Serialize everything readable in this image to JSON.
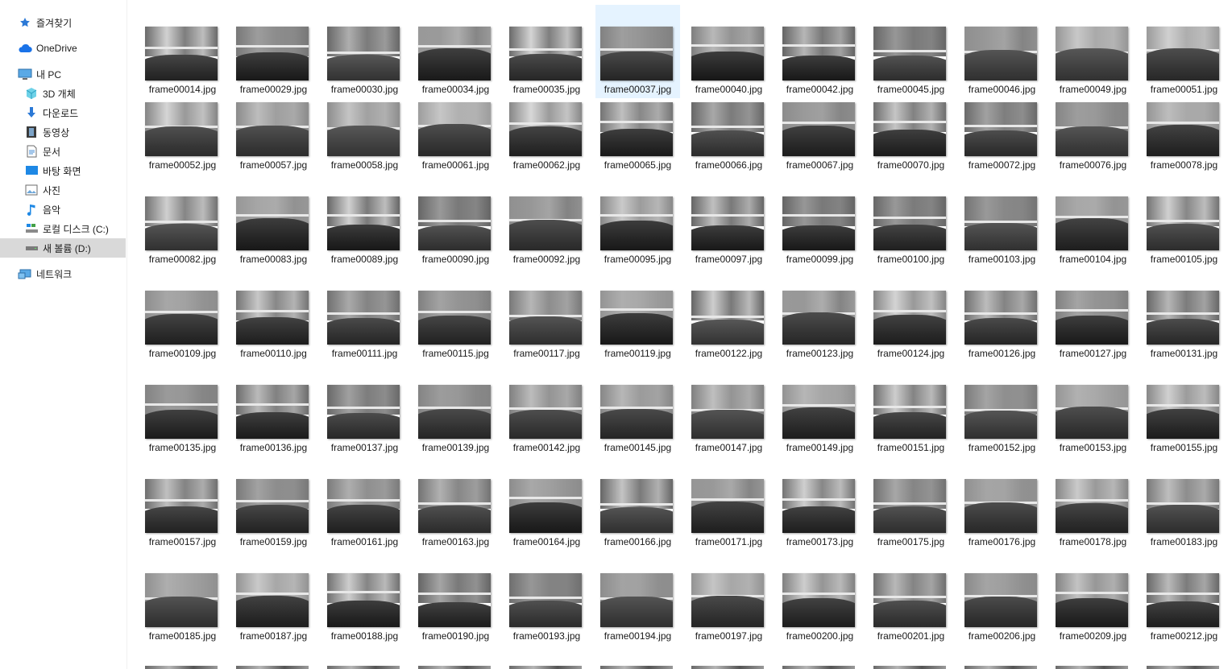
{
  "sidebar": {
    "items": [
      {
        "label": "즐겨찾기",
        "icon": "star-icon",
        "level": 0,
        "selected": false
      },
      {
        "label": "OneDrive",
        "icon": "cloud-icon",
        "level": 0,
        "selected": false
      },
      {
        "label": "내 PC",
        "icon": "computer-icon",
        "level": 0,
        "selected": false
      },
      {
        "label": "3D 개체",
        "icon": "cube-icon",
        "level": 1,
        "selected": false
      },
      {
        "label": "다운로드",
        "icon": "download-arrow-icon",
        "level": 1,
        "selected": false
      },
      {
        "label": "동영상",
        "icon": "film-icon",
        "level": 1,
        "selected": false
      },
      {
        "label": "문서",
        "icon": "document-icon",
        "level": 1,
        "selected": false
      },
      {
        "label": "바탕 화면",
        "icon": "desktop-icon",
        "level": 1,
        "selected": false
      },
      {
        "label": "사진",
        "icon": "picture-icon",
        "level": 1,
        "selected": false
      },
      {
        "label": "음악",
        "icon": "music-note-icon",
        "level": 1,
        "selected": false
      },
      {
        "label": "로컬 디스크 (C:)",
        "icon": "local-disk-icon",
        "level": 1,
        "selected": false
      },
      {
        "label": "새 볼륨 (D:)",
        "icon": "drive-icon",
        "level": 1,
        "selected": true
      },
      {
        "label": "네트워크",
        "icon": "network-icon",
        "level": 0,
        "selected": false
      }
    ]
  },
  "files": {
    "selected": "frame00037.jpg",
    "rows": [
      [
        "frame00014.jpg",
        "frame00029.jpg",
        "frame00030.jpg",
        "frame00034.jpg",
        "frame00035.jpg",
        "frame00037.jpg",
        "frame00040.jpg",
        "frame00042.jpg",
        "frame00045.jpg",
        "frame00046.jpg",
        "frame00049.jpg",
        "frame00051.jpg"
      ],
      [
        "frame00052.jpg",
        "frame00057.jpg",
        "frame00058.jpg",
        "frame00061.jpg",
        "frame00062.jpg",
        "frame00065.jpg",
        "frame00066.jpg",
        "frame00067.jpg",
        "frame00070.jpg",
        "frame00072.jpg",
        "frame00076.jpg",
        "frame00078.jpg"
      ],
      [
        "frame00082.jpg",
        "frame00083.jpg",
        "frame00089.jpg",
        "frame00090.jpg",
        "frame00092.jpg",
        "frame00095.jpg",
        "frame00097.jpg",
        "frame00099.jpg",
        "frame00100.jpg",
        "frame00103.jpg",
        "frame00104.jpg",
        "frame00105.jpg"
      ],
      [
        "frame00109.jpg",
        "frame00110.jpg",
        "frame00111.jpg",
        "frame00115.jpg",
        "frame00117.jpg",
        "frame00119.jpg",
        "frame00122.jpg",
        "frame00123.jpg",
        "frame00124.jpg",
        "frame00126.jpg",
        "frame00127.jpg",
        "frame00131.jpg"
      ],
      [
        "frame00135.jpg",
        "frame00136.jpg",
        "frame00137.jpg",
        "frame00139.jpg",
        "frame00142.jpg",
        "frame00145.jpg",
        "frame00147.jpg",
        "frame00149.jpg",
        "frame00151.jpg",
        "frame00152.jpg",
        "frame00153.jpg",
        "frame00155.jpg"
      ],
      [
        "frame00157.jpg",
        "frame00159.jpg",
        "frame00161.jpg",
        "frame00163.jpg",
        "frame00164.jpg",
        "frame00166.jpg",
        "frame00171.jpg",
        "frame00173.jpg",
        "frame00175.jpg",
        "frame00176.jpg",
        "frame00178.jpg",
        "frame00183.jpg"
      ],
      [
        "frame00185.jpg",
        "frame00187.jpg",
        "frame00188.jpg",
        "frame00190.jpg",
        "frame00193.jpg",
        "frame00194.jpg",
        "frame00197.jpg",
        "frame00200.jpg",
        "frame00201.jpg",
        "frame00206.jpg",
        "frame00209.jpg",
        "frame00212.jpg"
      ]
    ]
  },
  "colors": {
    "selected_tile": "#e5f3ff",
    "selected_nav": "#d9d9d9",
    "accent": "#0078d7"
  }
}
